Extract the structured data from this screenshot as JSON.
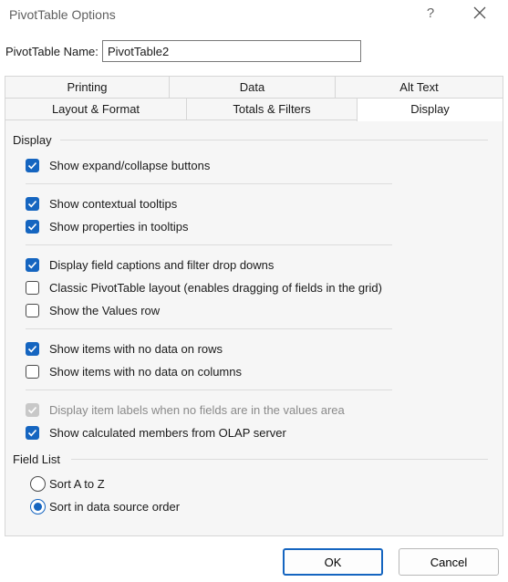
{
  "window": {
    "title": "PivotTable Options",
    "help_glyph": "?"
  },
  "name_field": {
    "label": "PivotTable Name:",
    "value": "PivotTable2"
  },
  "tabs_back": [
    "Printing",
    "Data",
    "Alt Text"
  ],
  "tabs_front": [
    "Layout & Format",
    "Totals & Filters",
    "Display"
  ],
  "active_tab": "Display",
  "display_section": {
    "title": "Display",
    "options": [
      {
        "label": "Show expand/collapse buttons",
        "checked": true,
        "disabled": false
      },
      {
        "label": "Show contextual tooltips",
        "checked": true,
        "disabled": false
      },
      {
        "label": "Show properties in tooltips",
        "checked": true,
        "disabled": false
      },
      {
        "label": "Display field captions and filter drop downs",
        "checked": true,
        "disabled": false
      },
      {
        "label": "Classic PivotTable layout (enables dragging of fields in the grid)",
        "checked": false,
        "disabled": false
      },
      {
        "label": "Show the Values row",
        "checked": false,
        "disabled": false
      },
      {
        "label": "Show items with no data on rows",
        "checked": true,
        "disabled": false
      },
      {
        "label": "Show items with no data on columns",
        "checked": false,
        "disabled": false
      },
      {
        "label": "Display item labels when no fields are in the values area",
        "checked": true,
        "disabled": true
      },
      {
        "label": "Show calculated members from OLAP server",
        "checked": true,
        "disabled": false
      }
    ]
  },
  "field_list_section": {
    "title": "Field List",
    "options": [
      {
        "label": "Sort A to Z",
        "selected": false
      },
      {
        "label": "Sort in data source order",
        "selected": true
      }
    ]
  },
  "buttons": {
    "ok": "OK",
    "cancel": "Cancel"
  },
  "colors": {
    "accent": "#1565c0",
    "panel": "#f6f6f6",
    "border": "#d6d6d6"
  }
}
